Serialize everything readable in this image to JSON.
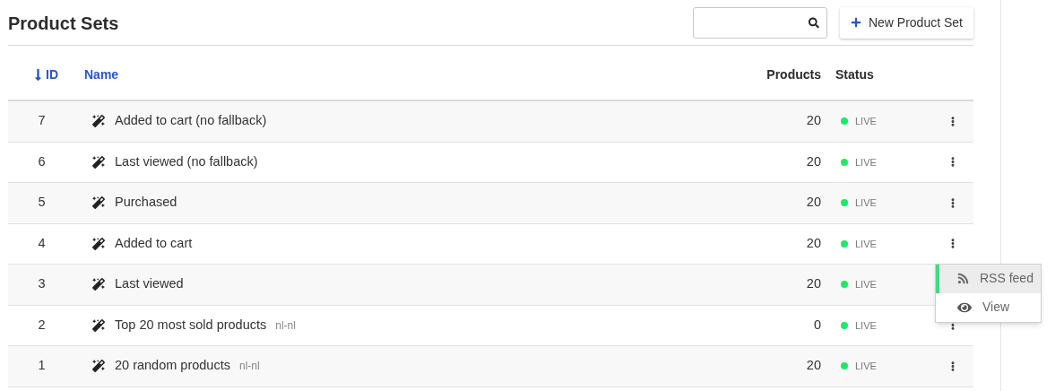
{
  "title": "Product Sets",
  "new_button": {
    "label": "New Product Set"
  },
  "columns": [
    {
      "label": "ID",
      "sortable": true,
      "sorted": true
    },
    {
      "label": "Name",
      "sortable": true,
      "sorted": false
    },
    {
      "label": "Products",
      "sortable": false,
      "sorted": false
    },
    {
      "label": "Status",
      "sortable": false,
      "sorted": false
    }
  ],
  "rows": [
    {
      "id": "7",
      "name": "Added to cart (no fallback)",
      "products": "20",
      "status": "LIVE",
      "menu_open": false
    },
    {
      "id": "6",
      "name": "Last viewed (no fallback)",
      "products": "20",
      "status": "LIVE",
      "menu_open": false
    },
    {
      "id": "5",
      "name": "Purchased",
      "products": "20",
      "status": "LIVE",
      "menu_open": false
    },
    {
      "id": "4",
      "name": "Added to cart",
      "products": "20",
      "status": "LIVE",
      "menu_open": true
    },
    {
      "id": "3",
      "name": "Last viewed",
      "products": "20",
      "status": "LIVE",
      "menu_open": false
    },
    {
      "id": "2",
      "name": "Top 20 most sold products",
      "locale": "nl-nl",
      "products": "0",
      "status": "LIVE",
      "menu_open": false
    },
    {
      "id": "1",
      "name": "20 random products",
      "locale": "nl-nl",
      "products": "20",
      "status": "LIVE",
      "menu_open": false
    }
  ],
  "row_menu": [
    {
      "kind": "rss",
      "label": "RSS feed",
      "selected": true
    },
    {
      "kind": "view",
      "label": "View",
      "selected": false
    }
  ]
}
